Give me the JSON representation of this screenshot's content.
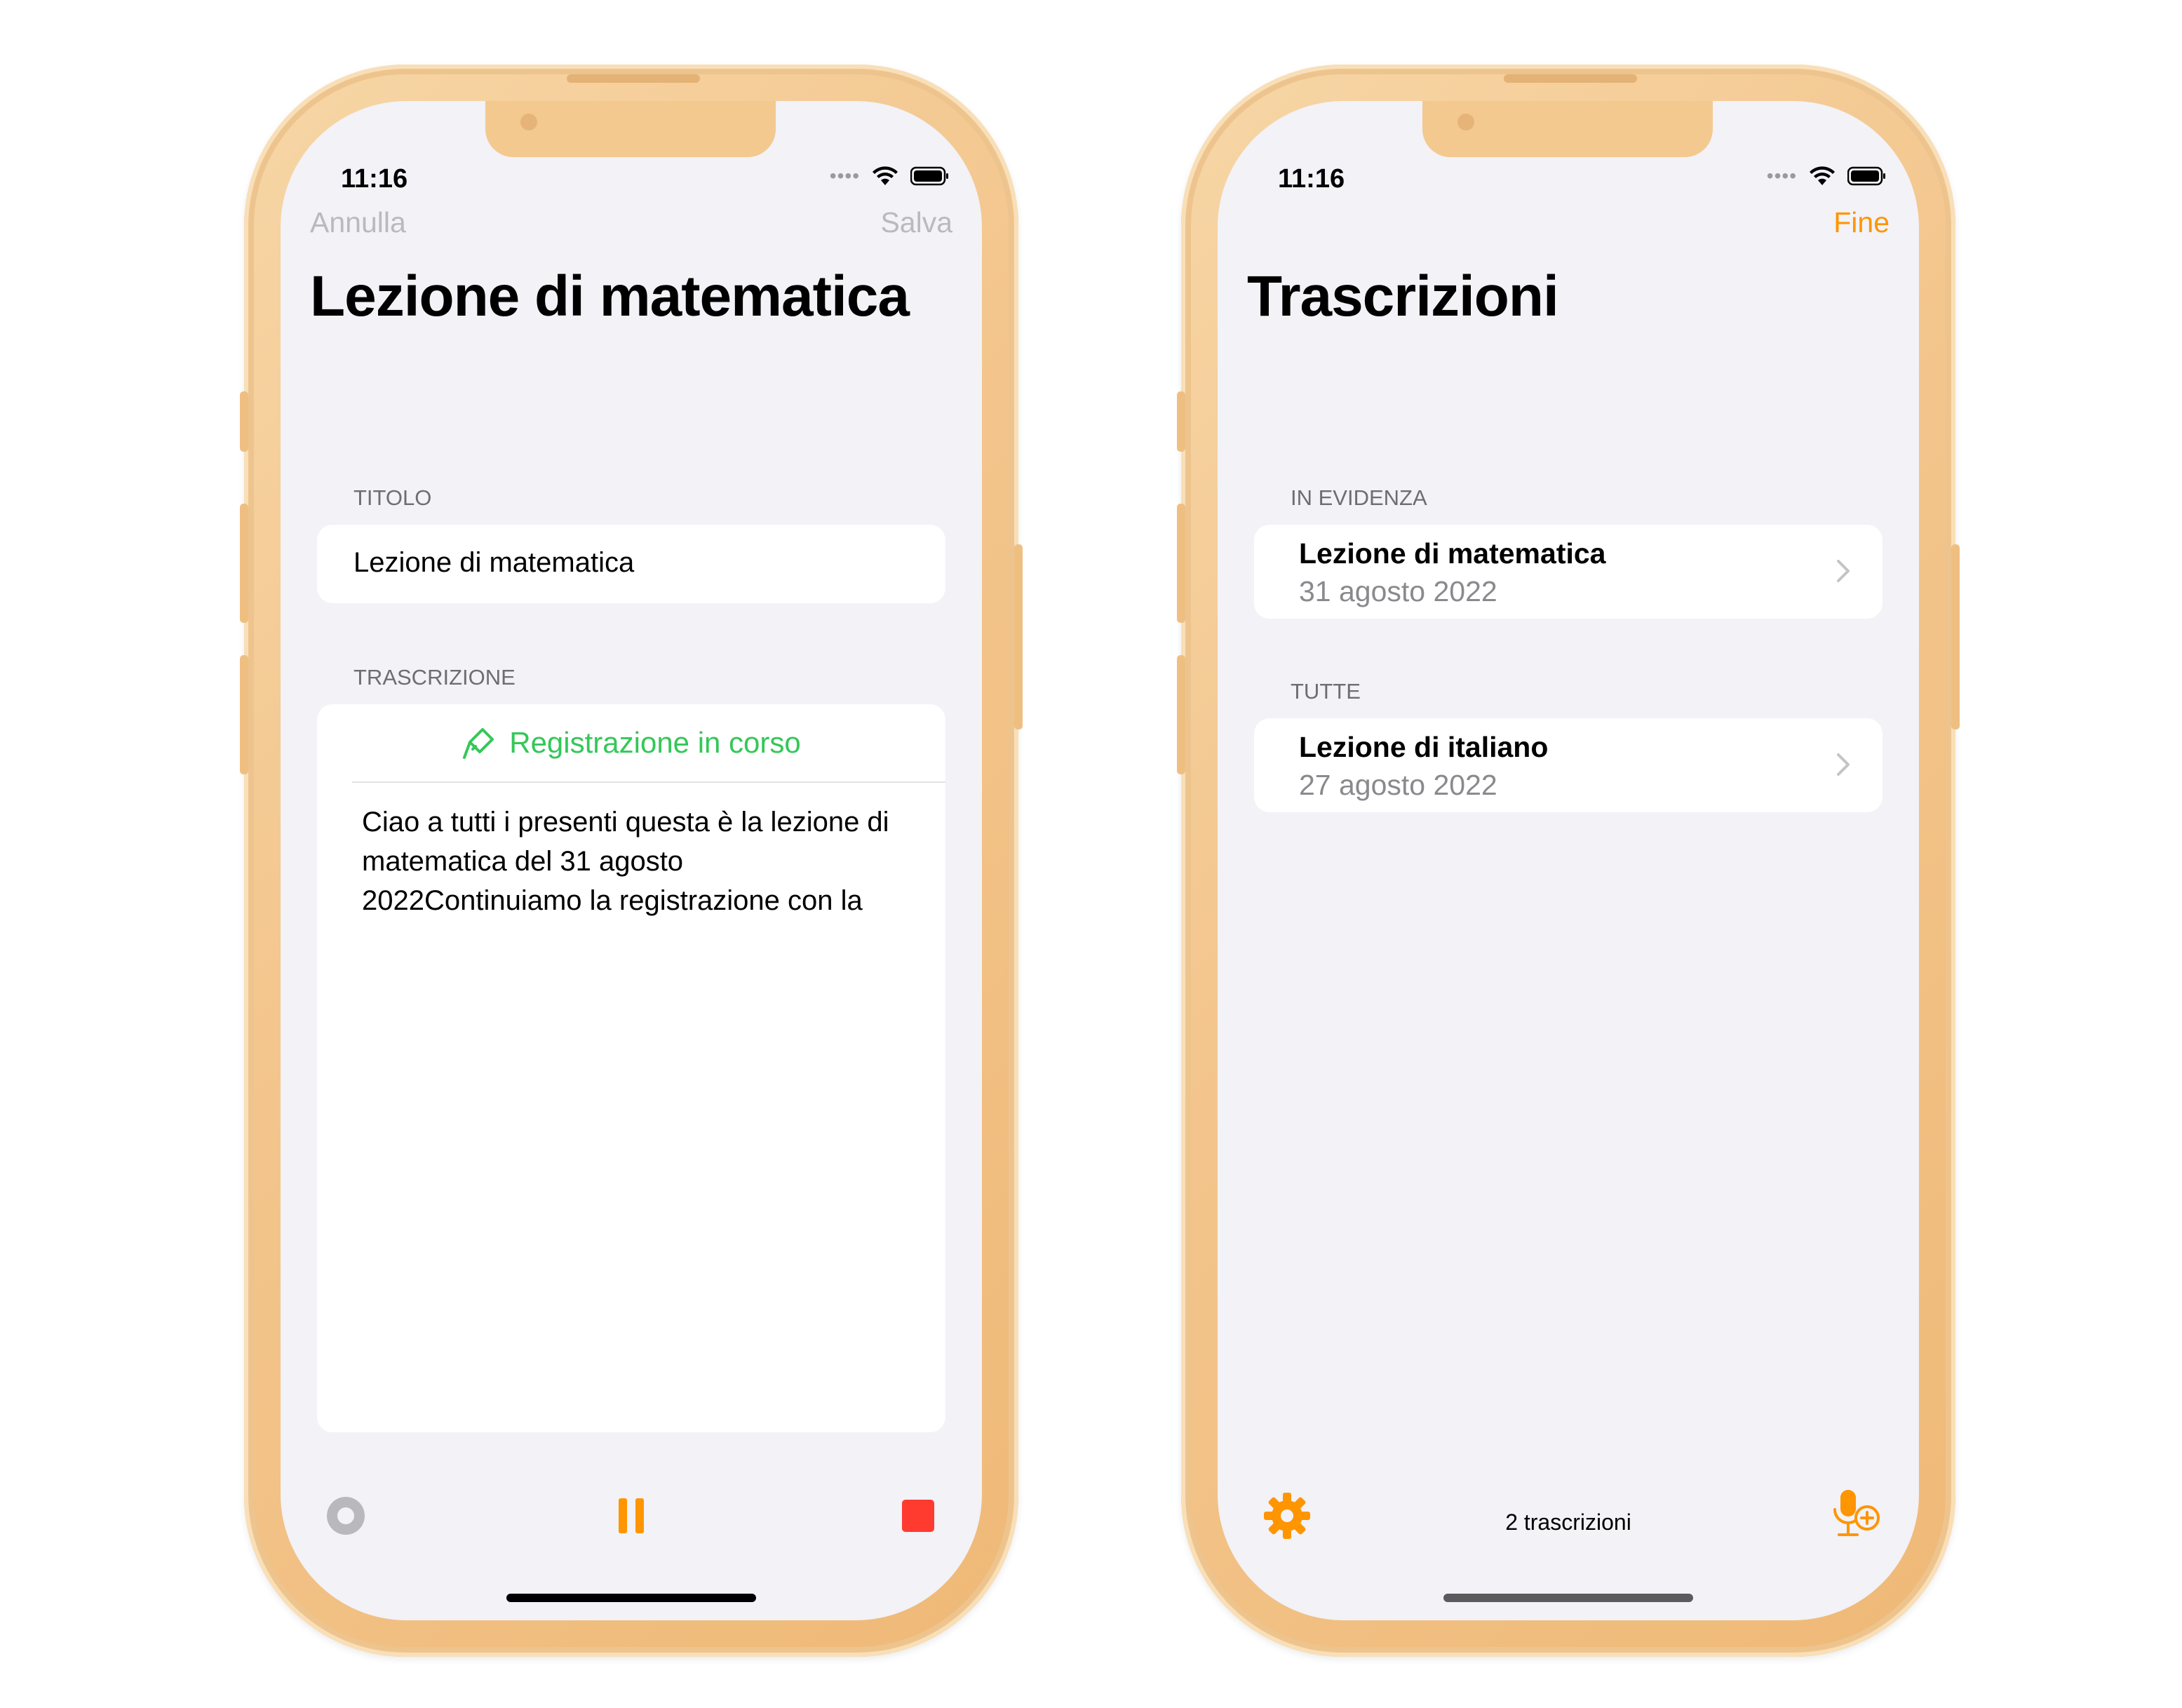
{
  "left_phone": {
    "status": {
      "time": "11:16"
    },
    "nav": {
      "cancel_label": "Annulla",
      "save_label": "Salva"
    },
    "title": "Lezione di matematica",
    "title_section": {
      "header": "TITOLO",
      "value": "Lezione di matematica"
    },
    "transcript_section": {
      "header": "TRASCRIZIONE",
      "recording_status": "Registrazione in corso",
      "text": "Ciao a tutti i presenti questa è la lezione di matematica del 31 agosto 2022Continuiamo la registrazione con la"
    },
    "toolbar": {
      "record_icon": "record-circle-icon",
      "pause_icon": "pause-icon",
      "stop_icon": "stop-icon"
    },
    "colors": {
      "recording": "#34c759",
      "pause": "#ff9500",
      "stop": "#ff3b30"
    }
  },
  "right_phone": {
    "status": {
      "time": "11:16"
    },
    "nav": {
      "done_label": "Fine"
    },
    "title": "Trascrizioni",
    "featured_section": {
      "header": "IN EVIDENZA",
      "items": [
        {
          "title": "Lezione di matematica",
          "date": "31 agosto 2022"
        }
      ]
    },
    "all_section": {
      "header": "TUTTE",
      "items": [
        {
          "title": "Lezione di italiano",
          "date": "27 agosto 2022"
        }
      ]
    },
    "toolbar": {
      "count_label": "2 trascrizioni",
      "settings_icon": "gear-icon",
      "new_icon": "mic-plus-icon"
    },
    "colors": {
      "accent": "#ff9500"
    }
  }
}
